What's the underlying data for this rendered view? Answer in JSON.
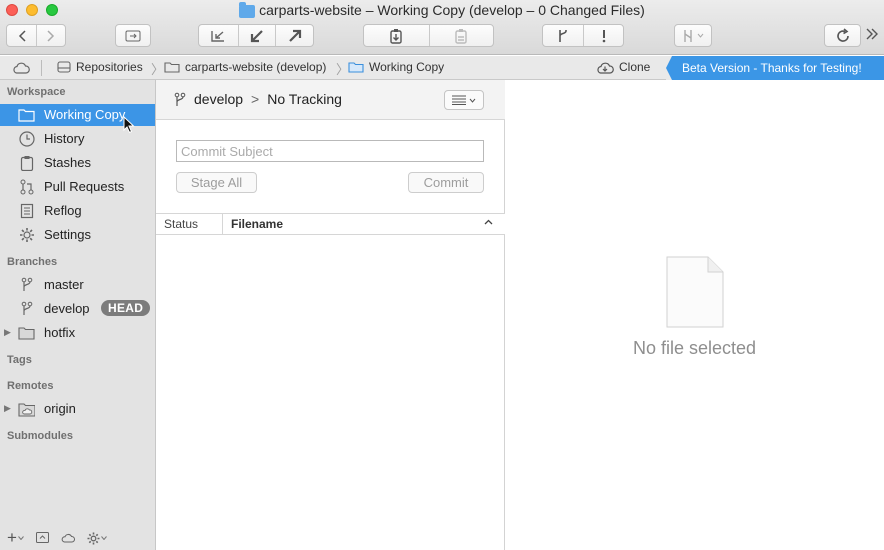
{
  "window": {
    "title": "carparts-website – Working Copy (develop – 0 Changed Files)"
  },
  "pathbar": {
    "items": [
      "Repositories",
      "carparts-website (develop)",
      "Working Copy"
    ],
    "clone_label": "Clone",
    "beta_label": "Beta Version - Thanks for Testing!"
  },
  "sidebar": {
    "workspace_header": "Workspace",
    "workspace_items": [
      {
        "label": "Working Copy",
        "icon": "folder-icon"
      },
      {
        "label": "History",
        "icon": "clock-icon"
      },
      {
        "label": "Stashes",
        "icon": "clipboard-icon"
      },
      {
        "label": "Pull Requests",
        "icon": "pull-request-icon"
      },
      {
        "label": "Reflog",
        "icon": "reflog-icon"
      },
      {
        "label": "Settings",
        "icon": "gear-icon"
      }
    ],
    "branches_header": "Branches",
    "branches": [
      {
        "label": "master"
      },
      {
        "label": "develop",
        "badge": "HEAD"
      },
      {
        "label": "hotfix"
      }
    ],
    "tags_header": "Tags",
    "remotes_header": "Remotes",
    "remotes": [
      {
        "label": "origin"
      }
    ],
    "submodules_header": "Submodules",
    "footer_add": "+"
  },
  "middle": {
    "branch": "develop",
    "separator": ">",
    "tracking": "No Tracking",
    "commit_placeholder": "Commit Subject",
    "stage_all_label": "Stage All",
    "commit_label": "Commit",
    "columns": {
      "status": "Status",
      "filename": "Filename"
    }
  },
  "detail": {
    "empty_text": "No file selected"
  },
  "colors": {
    "selection": "#3c95e6",
    "beta_banner": "#3b96e6",
    "head_badge": "#7c7c7c"
  }
}
